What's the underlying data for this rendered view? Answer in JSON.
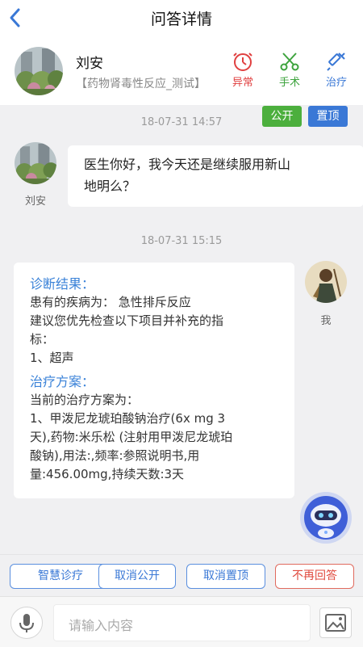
{
  "nav": {
    "title": "问答详情"
  },
  "patient": {
    "name": "刘安",
    "tag": "【药物肾毒性反应_测试】",
    "actions": [
      {
        "label": "异常",
        "icon": "alarm-clock-icon",
        "color": "#e04040"
      },
      {
        "label": "手术",
        "icon": "scissors-icon",
        "color": "#3da33d"
      },
      {
        "label": "治疗",
        "icon": "syringe-icon",
        "color": "#3a78d6"
      }
    ]
  },
  "chat": {
    "public_label": "公开",
    "top_label": "置顶",
    "time1": "18-07-31 14:57",
    "patient_name": "刘安",
    "patient_msg": [
      "医生你好，我今天还是继续服用新山",
      "地明么？"
    ],
    "time2": "18-07-31 15:15",
    "doctor_name": "我",
    "reply": {
      "diag_title": "诊断结果：",
      "diag_lines": [
        "患有的疾病为：  急性排斥反应",
        "建议您优先检查以下项目并补充的指",
        "标：",
        "1、超声"
      ],
      "plan_title": "治疗方案：",
      "plan_lines": [
        "当前的治疗方案为：",
        "1、甲泼尼龙琥珀酸钠治疗(6x mg 3",
        "天),药物:米乐松 (注射用甲泼尼龙琥珀",
        "酸钠),用法:,频率:参照说明书,用",
        "量:456.00mg,持续天数:3天"
      ]
    }
  },
  "actions": {
    "smart": "智慧诊疗",
    "cancel_public": "取消公开",
    "cancel_top": "取消置顶",
    "no_reply": "不再回答"
  },
  "input": {
    "placeholder": "请输入内容"
  },
  "colors": {
    "accent": "#3a78d6",
    "green": "#4caf3d",
    "red": "#e04040"
  }
}
